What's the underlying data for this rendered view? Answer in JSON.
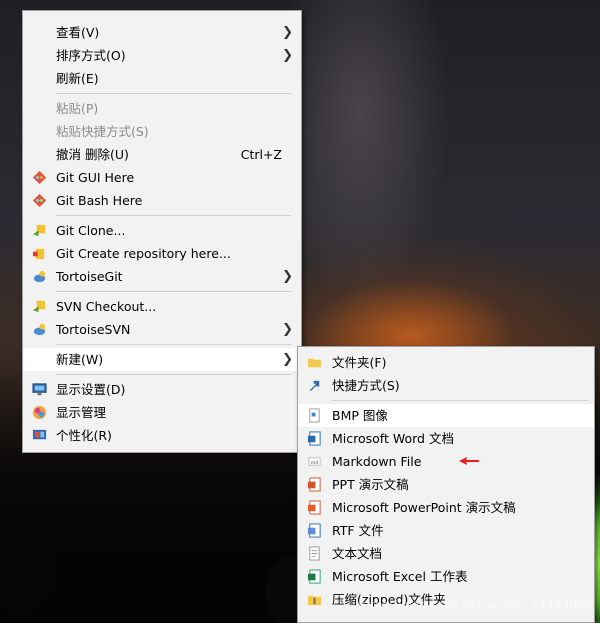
{
  "main_menu": {
    "items": [
      {
        "label": "查看(V)",
        "submenu": true
      },
      {
        "label": "排序方式(O)",
        "submenu": true
      },
      {
        "label": "刷新(E)"
      },
      {
        "label": "粘贴(P)",
        "disabled": true
      },
      {
        "label": "粘贴快捷方式(S)",
        "disabled": true
      },
      {
        "label": "撤消 删除(U)",
        "shortcut": "Ctrl+Z"
      },
      {
        "label": "Git GUI Here",
        "icon": "git-gui-icon"
      },
      {
        "label": "Git Bash Here",
        "icon": "git-bash-icon"
      },
      {
        "label": "Git Clone...",
        "icon": "tortoisegit-clone-icon"
      },
      {
        "label": "Git Create repository here...",
        "icon": "tortoisegit-create-repo-icon"
      },
      {
        "label": "TortoiseGit",
        "icon": "tortoisegit-icon",
        "submenu": true
      },
      {
        "label": "SVN Checkout...",
        "icon": "svn-checkout-icon"
      },
      {
        "label": "TortoiseSVN",
        "icon": "tortoisesvn-icon",
        "submenu": true
      },
      {
        "label": "新建(W)",
        "submenu": true,
        "highlighted": true
      },
      {
        "label": "显示设置(D)",
        "icon": "display-settings-icon"
      },
      {
        "label": "显示管理",
        "icon": "display-manager-icon"
      },
      {
        "label": "个性化(R)",
        "icon": "personalize-icon"
      }
    ]
  },
  "sub_menu": {
    "items": [
      {
        "label": "文件夹(F)",
        "icon": "folder-icon"
      },
      {
        "label": "快捷方式(S)",
        "icon": "shortcut-icon"
      },
      {
        "label": "BMP 图像",
        "icon": "bmp-image-icon",
        "highlighted": true
      },
      {
        "label": "Microsoft Word 文档",
        "icon": "word-document-icon"
      },
      {
        "label": "Markdown File",
        "icon": "markdown-file-icon"
      },
      {
        "label": "PPT 演示文稿",
        "icon": "ppt-icon"
      },
      {
        "label": "Microsoft PowerPoint 演示文稿",
        "icon": "powerpoint-icon"
      },
      {
        "label": "RTF 文件",
        "icon": "rtf-file-icon"
      },
      {
        "label": "文本文档",
        "icon": "text-document-icon"
      },
      {
        "label": "Microsoft Excel 工作表",
        "icon": "excel-icon"
      },
      {
        "label": "压缩(zipped)文件夹",
        "icon": "zip-folder-icon"
      }
    ]
  },
  "annotation": {
    "icon": "red-arrow-icon",
    "color": "#e81e1e"
  },
  "watermark": "https://blog.csdn.net/weixin_44403008",
  "colors": {
    "menu_bg": "#f2f2f2",
    "menu_highlight": "#ffffff",
    "disabled_text": "#8c8c8c"
  }
}
